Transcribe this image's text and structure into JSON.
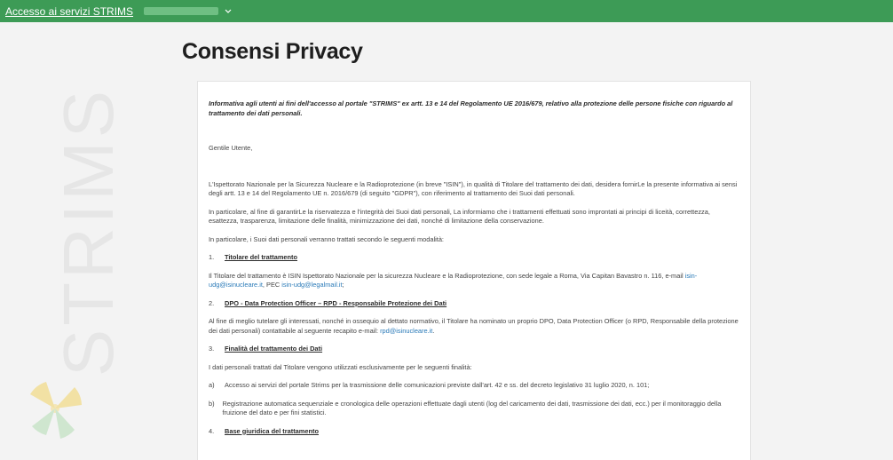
{
  "topbar": {
    "brand": "Accesso ai servizi STRIMS",
    "bg": "#3d9b56"
  },
  "sidebar": {
    "watermark": "STRIMS"
  },
  "page": {
    "title": "Consensi Privacy"
  },
  "doc": {
    "intro": "Informativa agli utenti ai fini dell'accesso al portale \"STRIMS\" ex artt. 13 e 14 del Regolamento UE 2016/679, relativo alla protezione delle persone fisiche con riguardo al trattamento dei dati personali.",
    "greeting": "Gentile Utente,",
    "p1": "L'Ispettorato Nazionale per la Sicurezza Nucleare e la Radioprotezione (in breve \"ISIN\"), in qualità di Titolare del trattamento dei dati, desidera fornirLe la presente informativa ai sensi degli artt. 13 e 14 del Regolamento UE n. 2016/679 (di seguito \"GDPR\"), con riferimento al trattamento dei Suoi dati personali.",
    "p2": "In particolare, al fine di garantirLe la riservatezza e l'integrità dei Suoi dati personali, La informiamo che i trattamenti effettuati sono improntati ai principi di liceità, correttezza, esattezza, trasparenza, limitazione delle finalità, minimizzazione dei dati, nonché di limitazione della conservazione.",
    "p3": "In particolare, i Suoi dati personali verranno trattati secondo le seguenti modalità:",
    "s1_num": "1.",
    "s1_title": "Titolare del trattamento",
    "s1_text": "Il Titolare del trattamento è ISIN Ispettorato Nazionale per la sicurezza Nucleare e la Radioprotezione, con sede legale a Roma, Via Capitan Bavastro n. 116, e-mail ",
    "s1_email": "isin-udg@isinucleare.it",
    "s1_pec_label": ", PEC ",
    "s1_pec": "isin-udg@legalmail.it",
    "s1_end": ";",
    "s2_num": "2.",
    "s2_title": "DPO - Data Protection Officer – RPD - Responsabile Protezione dei Dati",
    "s2_text": "Al fine di meglio tutelare gli interessati, nonché in ossequio al dettato normativo, il Titolare ha nominato un proprio DPO, Data Protection Officer (o RPD, Responsabile della protezione dei dati personali) contattabile al seguente recapito e-mail: ",
    "s2_email": "rpd@isinucleare.it",
    "s2_end": ".",
    "s3_num": "3.",
    "s3_title": "Finalità del trattamento dei Dati",
    "s3_text": "I dati personali trattati dal Titolare vengono utilizzati esclusivamente per le seguenti finalità:",
    "a_label": "a)",
    "a_text": "Accesso ai servizi del portale Strims per la trasmissione delle comunicazioni previste dall'art. 42 e ss. del decreto legislativo 31 luglio 2020, n. 101;",
    "b_label": "b)",
    "b_text": "Registrazione automatica sequenziale e cronologica delle operazioni effettuate dagli utenti (log del caricamento dei dati, trasmissione dei dati, ecc.) per il monitoraggio della fruizione del dato e per fini statistici.",
    "s4_num": "4.",
    "s4_title": "Base giuridica del trattamento"
  }
}
